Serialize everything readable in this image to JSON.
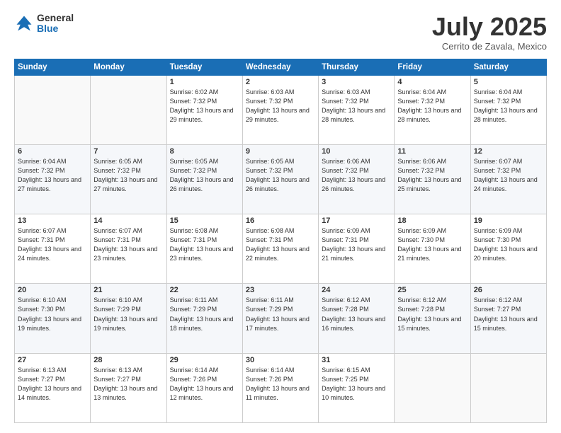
{
  "logo": {
    "general": "General",
    "blue": "Blue"
  },
  "title": "July 2025",
  "location": "Cerrito de Zavala, Mexico",
  "days_header": [
    "Sunday",
    "Monday",
    "Tuesday",
    "Wednesday",
    "Thursday",
    "Friday",
    "Saturday"
  ],
  "weeks": [
    [
      {
        "day": "",
        "info": ""
      },
      {
        "day": "",
        "info": ""
      },
      {
        "day": "1",
        "sunrise": "6:02 AM",
        "sunset": "7:32 PM",
        "daylight": "13 hours and 29 minutes."
      },
      {
        "day": "2",
        "sunrise": "6:03 AM",
        "sunset": "7:32 PM",
        "daylight": "13 hours and 29 minutes."
      },
      {
        "day": "3",
        "sunrise": "6:03 AM",
        "sunset": "7:32 PM",
        "daylight": "13 hours and 28 minutes."
      },
      {
        "day": "4",
        "sunrise": "6:04 AM",
        "sunset": "7:32 PM",
        "daylight": "13 hours and 28 minutes."
      },
      {
        "day": "5",
        "sunrise": "6:04 AM",
        "sunset": "7:32 PM",
        "daylight": "13 hours and 28 minutes."
      }
    ],
    [
      {
        "day": "6",
        "sunrise": "6:04 AM",
        "sunset": "7:32 PM",
        "daylight": "13 hours and 27 minutes."
      },
      {
        "day": "7",
        "sunrise": "6:05 AM",
        "sunset": "7:32 PM",
        "daylight": "13 hours and 27 minutes."
      },
      {
        "day": "8",
        "sunrise": "6:05 AM",
        "sunset": "7:32 PM",
        "daylight": "13 hours and 26 minutes."
      },
      {
        "day": "9",
        "sunrise": "6:05 AM",
        "sunset": "7:32 PM",
        "daylight": "13 hours and 26 minutes."
      },
      {
        "day": "10",
        "sunrise": "6:06 AM",
        "sunset": "7:32 PM",
        "daylight": "13 hours and 26 minutes."
      },
      {
        "day": "11",
        "sunrise": "6:06 AM",
        "sunset": "7:32 PM",
        "daylight": "13 hours and 25 minutes."
      },
      {
        "day": "12",
        "sunrise": "6:07 AM",
        "sunset": "7:32 PM",
        "daylight": "13 hours and 24 minutes."
      }
    ],
    [
      {
        "day": "13",
        "sunrise": "6:07 AM",
        "sunset": "7:31 PM",
        "daylight": "13 hours and 24 minutes."
      },
      {
        "day": "14",
        "sunrise": "6:07 AM",
        "sunset": "7:31 PM",
        "daylight": "13 hours and 23 minutes."
      },
      {
        "day": "15",
        "sunrise": "6:08 AM",
        "sunset": "7:31 PM",
        "daylight": "13 hours and 23 minutes."
      },
      {
        "day": "16",
        "sunrise": "6:08 AM",
        "sunset": "7:31 PM",
        "daylight": "13 hours and 22 minutes."
      },
      {
        "day": "17",
        "sunrise": "6:09 AM",
        "sunset": "7:31 PM",
        "daylight": "13 hours and 21 minutes."
      },
      {
        "day": "18",
        "sunrise": "6:09 AM",
        "sunset": "7:30 PM",
        "daylight": "13 hours and 21 minutes."
      },
      {
        "day": "19",
        "sunrise": "6:09 AM",
        "sunset": "7:30 PM",
        "daylight": "13 hours and 20 minutes."
      }
    ],
    [
      {
        "day": "20",
        "sunrise": "6:10 AM",
        "sunset": "7:30 PM",
        "daylight": "13 hours and 19 minutes."
      },
      {
        "day": "21",
        "sunrise": "6:10 AM",
        "sunset": "7:29 PM",
        "daylight": "13 hours and 19 minutes."
      },
      {
        "day": "22",
        "sunrise": "6:11 AM",
        "sunset": "7:29 PM",
        "daylight": "13 hours and 18 minutes."
      },
      {
        "day": "23",
        "sunrise": "6:11 AM",
        "sunset": "7:29 PM",
        "daylight": "13 hours and 17 minutes."
      },
      {
        "day": "24",
        "sunrise": "6:12 AM",
        "sunset": "7:28 PM",
        "daylight": "13 hours and 16 minutes."
      },
      {
        "day": "25",
        "sunrise": "6:12 AM",
        "sunset": "7:28 PM",
        "daylight": "13 hours and 15 minutes."
      },
      {
        "day": "26",
        "sunrise": "6:12 AM",
        "sunset": "7:27 PM",
        "daylight": "13 hours and 15 minutes."
      }
    ],
    [
      {
        "day": "27",
        "sunrise": "6:13 AM",
        "sunset": "7:27 PM",
        "daylight": "13 hours and 14 minutes."
      },
      {
        "day": "28",
        "sunrise": "6:13 AM",
        "sunset": "7:27 PM",
        "daylight": "13 hours and 13 minutes."
      },
      {
        "day": "29",
        "sunrise": "6:14 AM",
        "sunset": "7:26 PM",
        "daylight": "13 hours and 12 minutes."
      },
      {
        "day": "30",
        "sunrise": "6:14 AM",
        "sunset": "7:26 PM",
        "daylight": "13 hours and 11 minutes."
      },
      {
        "day": "31",
        "sunrise": "6:15 AM",
        "sunset": "7:25 PM",
        "daylight": "13 hours and 10 minutes."
      },
      {
        "day": "",
        "info": ""
      },
      {
        "day": "",
        "info": ""
      }
    ]
  ]
}
